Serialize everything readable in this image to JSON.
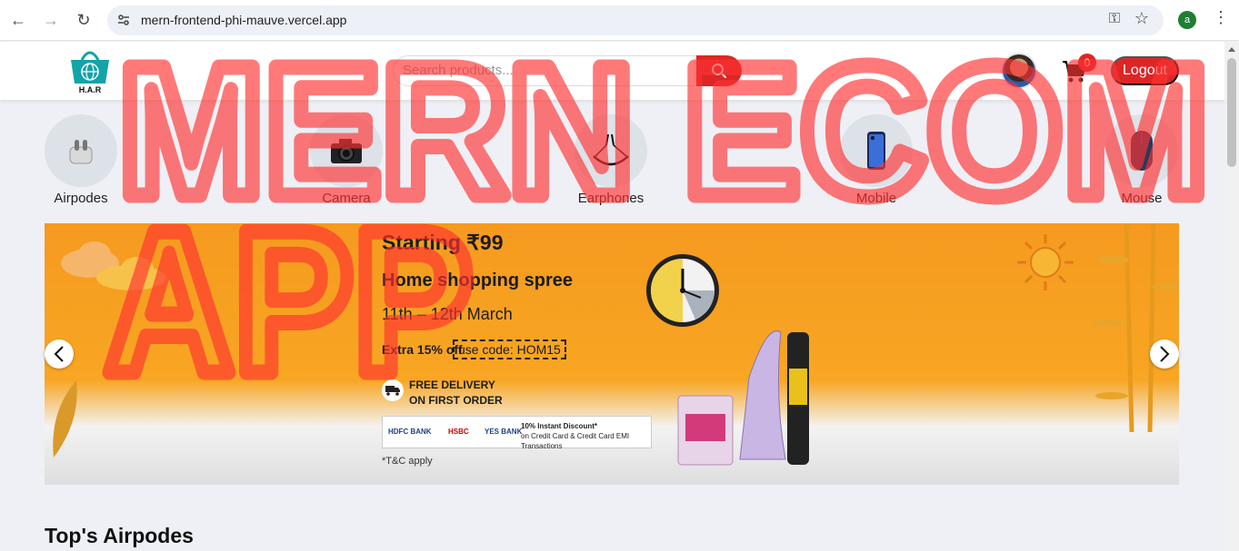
{
  "browser": {
    "url": "mern-frontend-phi-mauve.vercel.app",
    "profile_initial": "a",
    "back_icon": "arrow-left-icon",
    "forward_icon": "arrow-right-icon",
    "reload_icon": "reload-icon"
  },
  "header": {
    "logo_text": "H.A.R",
    "search_placeholder": "Search products...",
    "cart_count": "0",
    "logout_label": "Logout"
  },
  "categories": [
    {
      "label": "Airpodes",
      "icon": "airpods-icon"
    },
    {
      "label": "Camera",
      "icon": "camera-icon"
    },
    {
      "label": "Earphones",
      "icon": "earphones-icon"
    },
    {
      "label": "Mobile",
      "icon": "mobile-icon"
    },
    {
      "label": "Mouse",
      "icon": "mouse-icon"
    }
  ],
  "banner": {
    "starting": "Starting ₹99",
    "title": "Home shopping spree",
    "dates": "11th – 12th March",
    "extra": "Extra 15% off",
    "code": "use code: HOM15",
    "free_line1": "FREE DELIVERY",
    "free_line2": "ON FIRST ORDER",
    "bank_hdfc": "HDFC BANK",
    "bank_hsbc": "HSBC",
    "bank_yes": "YES BANK",
    "discount_line1": "10% Instant Discount*",
    "discount_line2": "on Credit Card & Credit Card EMI Transactions",
    "tc": "*T&C apply"
  },
  "section": {
    "title": "Top's Airpodes"
  },
  "overlay": {
    "line1": "MERN ECOM",
    "line2": "APP"
  },
  "colors": {
    "accent": "#dc2626",
    "banner_orange": "#f8a623",
    "overlay_red": "#ff3131"
  }
}
